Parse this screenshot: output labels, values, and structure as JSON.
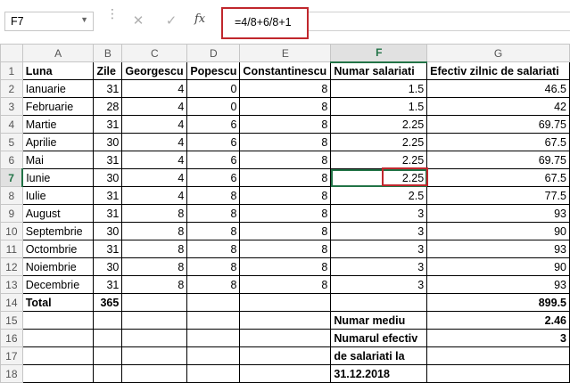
{
  "formula_bar": {
    "name_box": "F7",
    "name_arrow": "▼",
    "dots": "⋮",
    "cancel_icon": "✕",
    "enter_icon": "✓",
    "fx_label": "fx",
    "formula": "=4/8+6/8+1"
  },
  "columns": [
    "A",
    "B",
    "C",
    "D",
    "E",
    "F",
    "G"
  ],
  "selected_column": "F",
  "rows": [
    {
      "n": "1",
      "c": [
        "Luna",
        "Zile",
        "Georgescu",
        "Popescu",
        "Constantinescu",
        "Numar salariati",
        "Efectiv zilnic de salariati"
      ]
    },
    {
      "n": "2",
      "c": [
        "Ianuarie",
        "31",
        "4",
        "0",
        "8",
        "1.5",
        "46.5"
      ]
    },
    {
      "n": "3",
      "c": [
        "Februarie",
        "28",
        "4",
        "0",
        "8",
        "1.5",
        "42"
      ]
    },
    {
      "n": "4",
      "c": [
        "Martie",
        "31",
        "4",
        "6",
        "8",
        "2.25",
        "69.75"
      ]
    },
    {
      "n": "5",
      "c": [
        "Aprilie",
        "30",
        "4",
        "6",
        "8",
        "2.25",
        "67.5"
      ]
    },
    {
      "n": "6",
      "c": [
        "Mai",
        "31",
        "4",
        "6",
        "8",
        "2.25",
        "69.75"
      ]
    },
    {
      "n": "7",
      "c": [
        "Iunie",
        "30",
        "4",
        "6",
        "8",
        "2.25",
        "67.5"
      ]
    },
    {
      "n": "8",
      "c": [
        "Iulie",
        "31",
        "4",
        "8",
        "8",
        "2.5",
        "77.5"
      ]
    },
    {
      "n": "9",
      "c": [
        "August",
        "31",
        "8",
        "8",
        "8",
        "3",
        "93"
      ]
    },
    {
      "n": "10",
      "c": [
        "Septembrie",
        "30",
        "8",
        "8",
        "8",
        "3",
        "90"
      ]
    },
    {
      "n": "11",
      "c": [
        "Octombrie",
        "31",
        "8",
        "8",
        "8",
        "3",
        "93"
      ]
    },
    {
      "n": "12",
      "c": [
        "Noiembrie",
        "30",
        "8",
        "8",
        "8",
        "3",
        "90"
      ]
    },
    {
      "n": "13",
      "c": [
        "Decembrie",
        "31",
        "8",
        "8",
        "8",
        "3",
        "93"
      ]
    },
    {
      "n": "14",
      "c": [
        "Total",
        "365",
        "",
        "",
        "",
        "",
        "899.5"
      ]
    },
    {
      "n": "15",
      "c": [
        "",
        "",
        "",
        "",
        "",
        "Numar mediu",
        "2.46"
      ]
    },
    {
      "n": "16",
      "c": [
        "",
        "",
        "",
        "",
        "",
        "Numarul efectiv",
        "3"
      ]
    },
    {
      "n": "17",
      "c": [
        "",
        "",
        "",
        "",
        "",
        "de salariati la",
        ""
      ]
    },
    {
      "n": "18",
      "c": [
        "",
        "",
        "",
        "",
        "",
        "31.12.2018",
        ""
      ]
    }
  ],
  "selected_row": "7",
  "accent_color": "#217346",
  "highlight_color": "#c0272d"
}
